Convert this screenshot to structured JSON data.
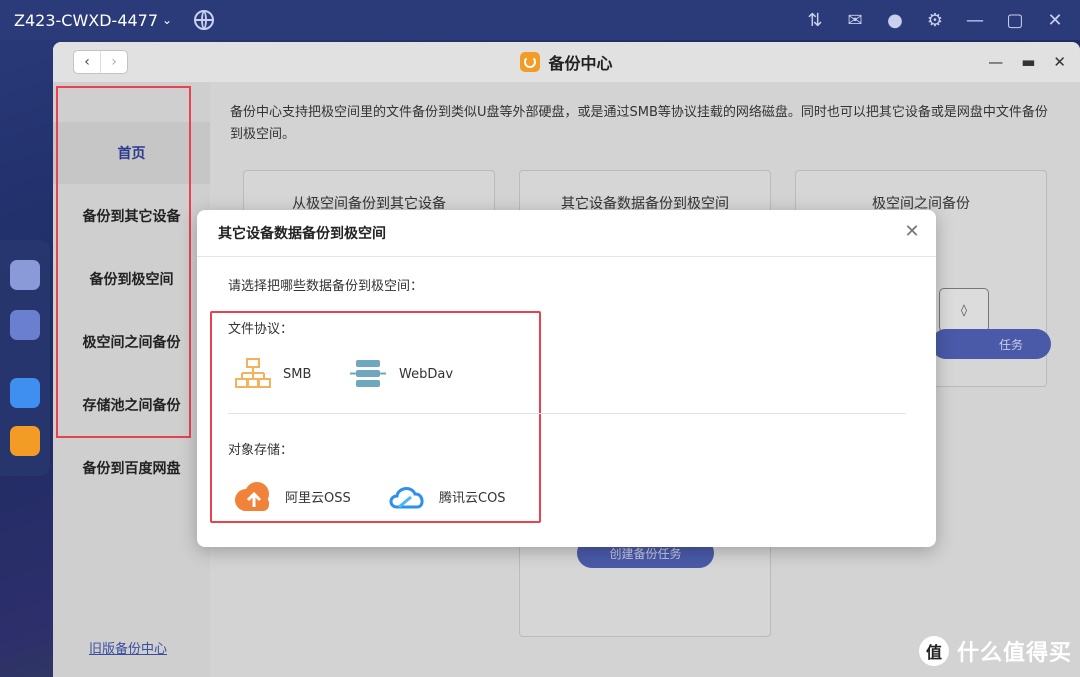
{
  "os_bar": {
    "device_name": "Z423-CWXD-4477",
    "icons": [
      "globe-icon",
      "transfer-icon",
      "mail-icon",
      "user-icon",
      "gear-icon",
      "minimize-icon",
      "maximize-icon",
      "close-icon"
    ]
  },
  "window": {
    "title": "备份中心",
    "nav": {
      "back": "‹",
      "forward": "›"
    },
    "controls": {
      "minimize": "—",
      "restore": "▬",
      "close": "✕"
    }
  },
  "sidebar": {
    "items": [
      {
        "label": "首页",
        "active": true
      },
      {
        "label": "备份到其它设备",
        "active": false
      },
      {
        "label": "备份到极空间",
        "active": false
      },
      {
        "label": "极空间之间备份",
        "active": false
      },
      {
        "label": "存储池之间备份",
        "active": false
      },
      {
        "label": "备份到百度网盘",
        "active": false
      }
    ],
    "old_link": "旧版备份中心"
  },
  "main": {
    "intro": "备份中心支持把极空间里的文件备份到类似U盘等外部硬盘，或是通过SMB等协议挂载的网络磁盘。同时也可以把其它设备或是网盘中文件备份到极空间。",
    "cards": [
      {
        "title": "从极空间备份到其它设备"
      },
      {
        "title": "其它设备数据备份到极空间"
      },
      {
        "title": "极空间之间备份"
      }
    ],
    "create_button": "创建备份任务",
    "card3_button_partial": "任务"
  },
  "modal": {
    "title": "其它设备数据备份到极空间",
    "prompt": "请选择把哪些数据备份到极空间：",
    "sections": {
      "protocol": {
        "label": "文件协议：",
        "options": [
          {
            "label": "SMB",
            "icon": "network-icon",
            "color": "#f4b25a"
          },
          {
            "label": "WebDav",
            "icon": "server-icon",
            "color": "#6fa7bf"
          }
        ]
      },
      "object_storage": {
        "label": "对象存储：",
        "options": [
          {
            "label": "阿里云OSS",
            "icon": "aliyun-cloud-icon",
            "color": "#f0823a"
          },
          {
            "label": "腾讯云COS",
            "icon": "tencent-cloud-icon",
            "color": "#2f8ff0"
          }
        ]
      }
    }
  },
  "watermark": {
    "badge": "值",
    "text": "什么值得买"
  },
  "colors": {
    "accent": "#4a5aa8",
    "highlight": "#e8424f",
    "brand_orange": "#f39c25"
  }
}
